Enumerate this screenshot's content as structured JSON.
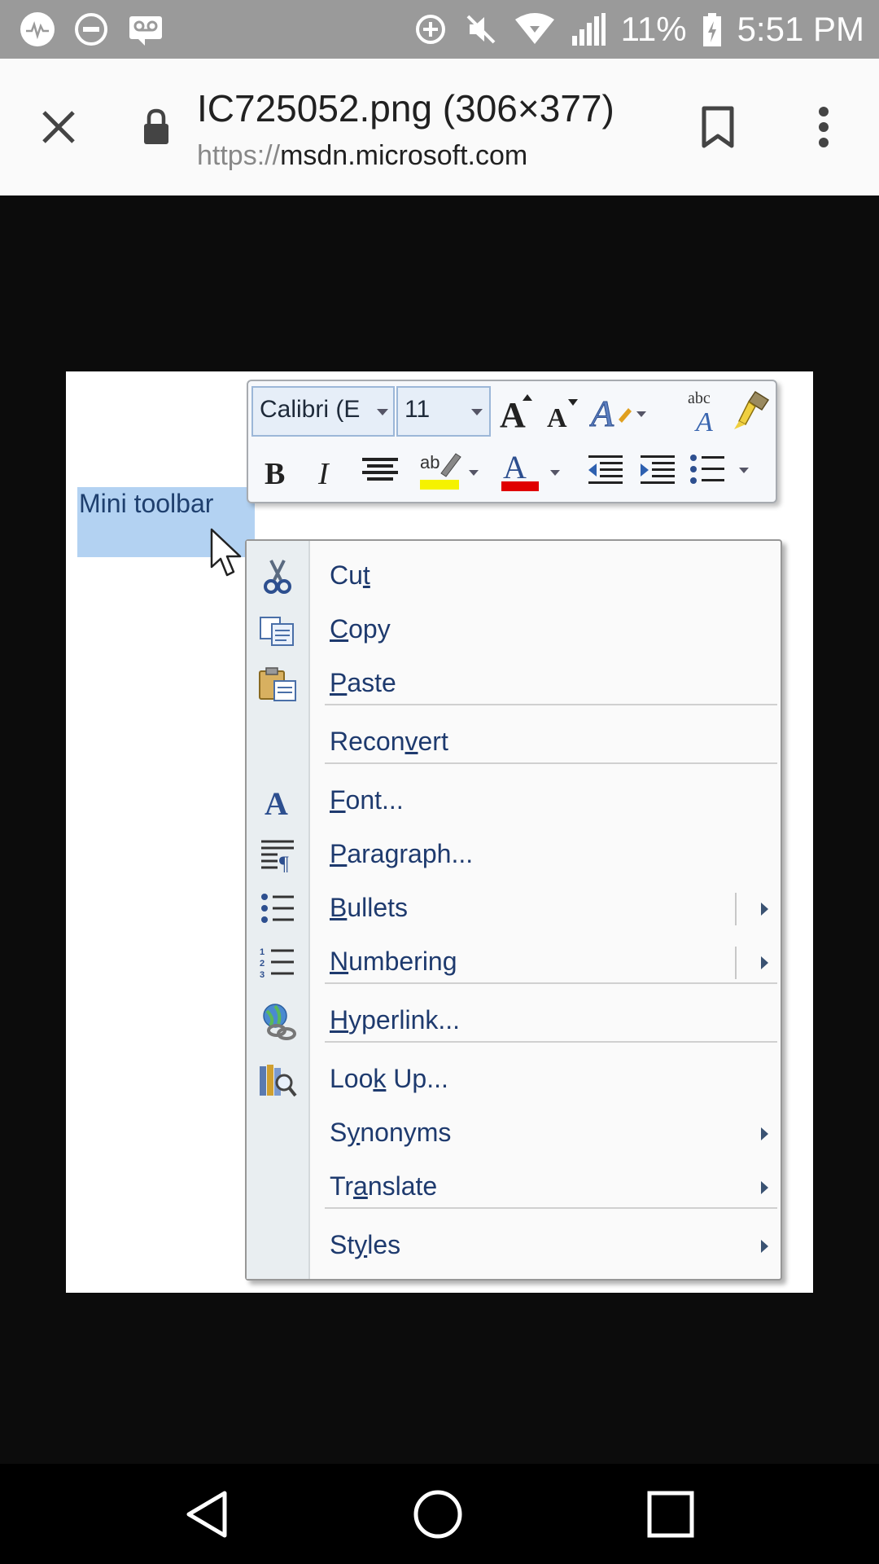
{
  "status_bar": {
    "icons_left": [
      "pulse-icon",
      "do-not-disturb-icon",
      "voicemail-icon"
    ],
    "icons_right": [
      "data-saver-icon",
      "mute-icon",
      "wifi-icon",
      "signal-icon",
      "battery-icon"
    ],
    "battery": "11%",
    "time": "5:51 PM"
  },
  "app_bar": {
    "title": "IC725052.png (306×377)",
    "url_scheme": "https://",
    "url_host": "msdn.microsoft.com"
  },
  "screenshot": {
    "selection_text": "Mini toolbar",
    "mini_toolbar": {
      "font_name": "Calibri (E",
      "font_size": "11",
      "highlight_color": "#f5f200",
      "font_color": "#e00000"
    },
    "context_menu": {
      "items": [
        {
          "pre": "Cu",
          "ul": "t",
          "post": "",
          "icon": "scissors-icon"
        },
        {
          "pre": "",
          "ul": "C",
          "post": "opy",
          "icon": "copy-icon"
        },
        {
          "pre": "",
          "ul": "P",
          "post": "aste",
          "icon": "paste-icon"
        },
        {
          "pre": "Recon",
          "ul": "v",
          "post": "ert",
          "icon": ""
        },
        {
          "pre": "",
          "ul": "F",
          "post": "ont...",
          "icon": "font-icon"
        },
        {
          "pre": "",
          "ul": "P",
          "post": "aragraph...",
          "icon": "paragraph-icon"
        },
        {
          "pre": "",
          "ul": "B",
          "post": "ullets",
          "icon": "bullets-icon"
        },
        {
          "pre": "",
          "ul": "N",
          "post": "umbering",
          "icon": "numbering-icon"
        },
        {
          "pre": "",
          "ul": "H",
          "post": "yperlink...",
          "icon": "hyperlink-icon"
        },
        {
          "pre": "Loo",
          "ul": "k",
          "post": " Up...",
          "icon": "lookup-icon"
        },
        {
          "pre": "S",
          "ul": "y",
          "post": "nonyms",
          "icon": ""
        },
        {
          "pre": "Tr",
          "ul": "a",
          "post": "nslate",
          "icon": ""
        },
        {
          "pre": "St",
          "ul": "y",
          "post": "les",
          "icon": ""
        }
      ]
    }
  }
}
